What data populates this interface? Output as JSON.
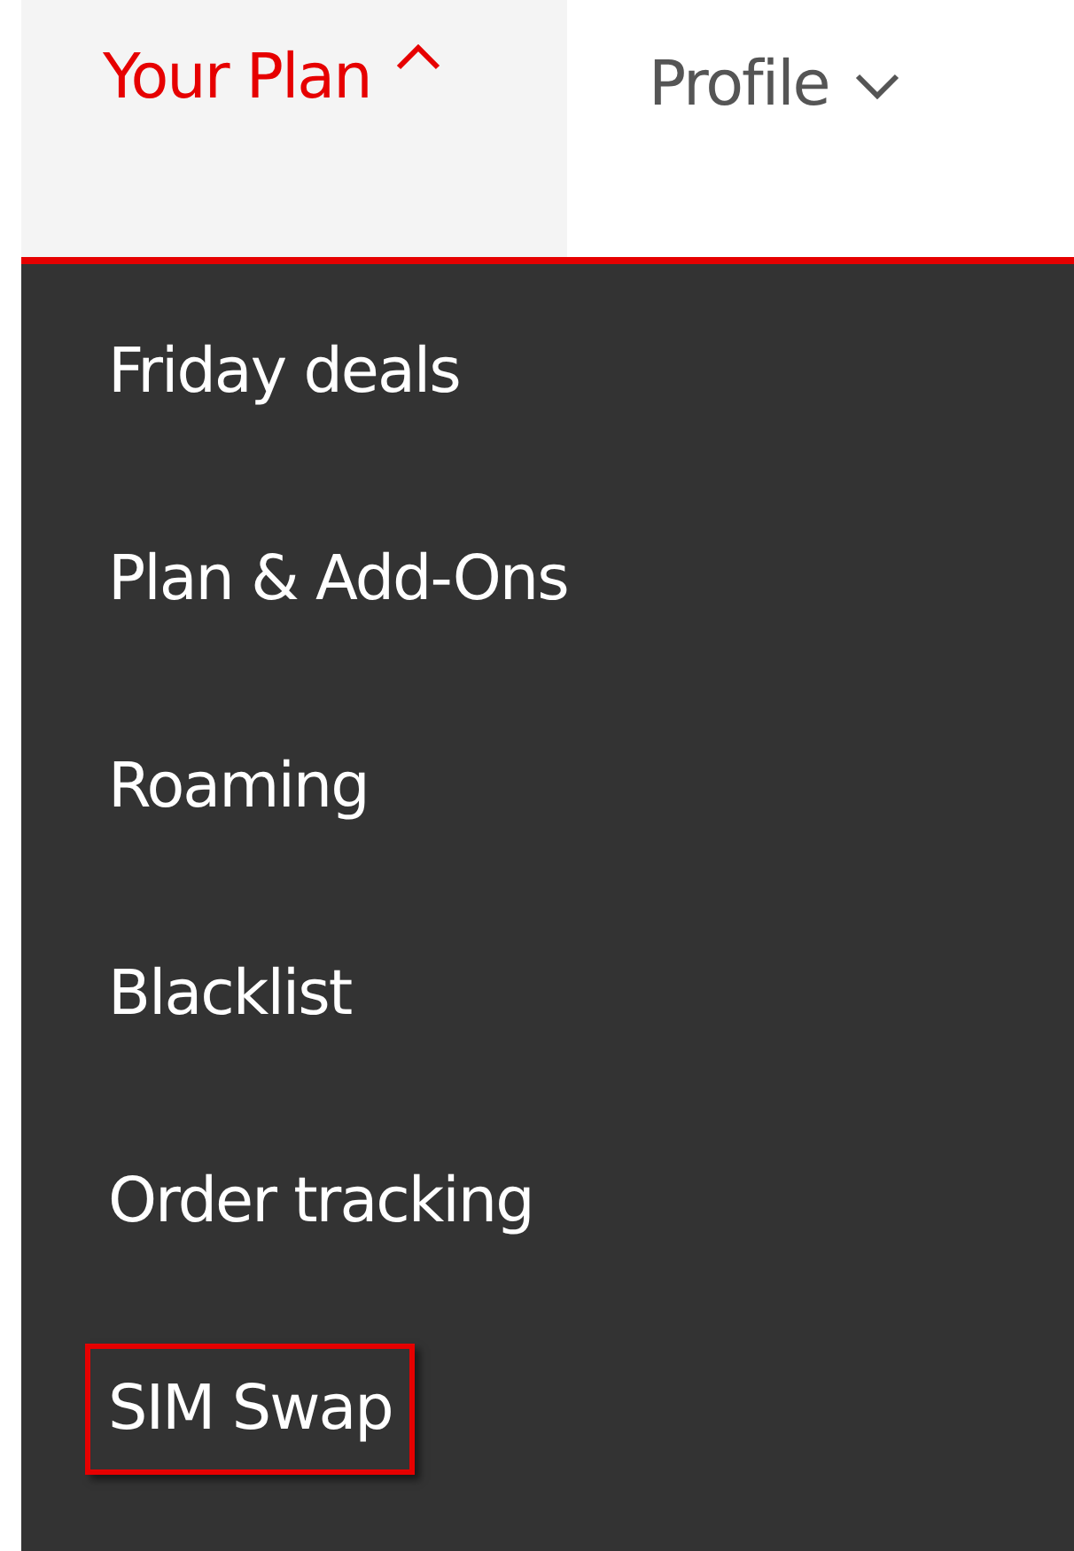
{
  "nav_tabs": [
    {
      "label": "Your Plan",
      "selected": true,
      "expanded": true
    },
    {
      "label": "Profile",
      "selected": false,
      "expanded": false
    }
  ],
  "dropdown_menu": {
    "items": [
      {
        "label": "Friday deals",
        "highlighted": false
      },
      {
        "label": "Plan & Add-Ons",
        "highlighted": false
      },
      {
        "label": "Roaming",
        "highlighted": false
      },
      {
        "label": "Blacklist",
        "highlighted": false
      },
      {
        "label": "Order tracking",
        "highlighted": false
      },
      {
        "label": "SIM Swap",
        "highlighted": true
      }
    ]
  }
}
